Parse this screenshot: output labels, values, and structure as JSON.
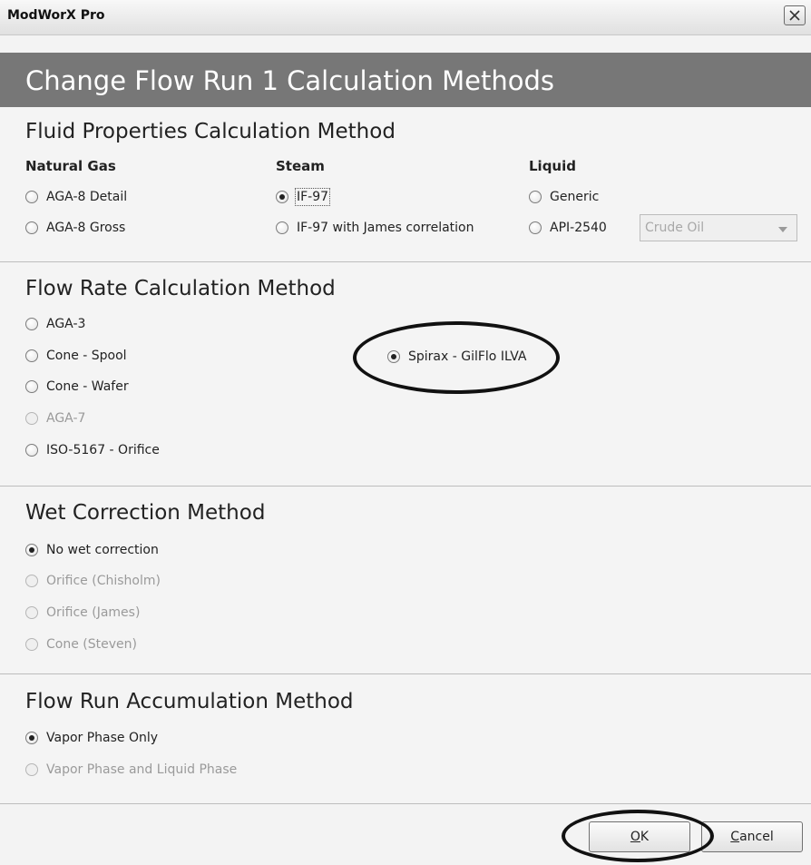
{
  "window": {
    "title": "ModWorX Pro"
  },
  "banner": {
    "title": "Change Flow Run 1 Calculation Methods"
  },
  "fluid": {
    "title": "Fluid Properties Calculation Method",
    "natural_gas": {
      "heading": "Natural Gas",
      "options": [
        "AGA-8 Detail",
        "AGA-8 Gross"
      ]
    },
    "steam": {
      "heading": "Steam",
      "options": [
        "IF-97",
        "IF-97 with James correlation"
      ],
      "selected": "IF-97"
    },
    "liquid": {
      "heading": "Liquid",
      "options": [
        "Generic",
        "API-2540"
      ],
      "select_value": "Crude Oil"
    }
  },
  "flow_rate": {
    "title": "Flow Rate Calculation Method",
    "options": [
      "AGA-3",
      "Cone - Spool",
      "Cone - Wafer",
      "AGA-7",
      "ISO-5167 - Orifice",
      "Spirax - GilFlo ILVA"
    ],
    "selected": "Spirax - GilFlo ILVA",
    "disabled": [
      "AGA-7"
    ]
  },
  "wet": {
    "title": "Wet Correction Method",
    "options": [
      "No wet correction",
      "Orifice (Chisholm)",
      "Orifice (James)",
      "Cone (Steven)"
    ],
    "selected": "No wet correction"
  },
  "accumulation": {
    "title": "Flow Run Accumulation Method",
    "options": [
      "Vapor Phase Only",
      "Vapor Phase and Liquid Phase"
    ],
    "selected": "Vapor Phase Only"
  },
  "buttons": {
    "ok_mnemonic": "O",
    "ok_rest": "K",
    "cancel_mnemonic": "C",
    "cancel_rest": "ancel"
  },
  "icons": {
    "close": "close-icon",
    "dropdown": "chevron-down-icon"
  },
  "colors": {
    "banner": "#777777",
    "annotation": "#111111"
  }
}
